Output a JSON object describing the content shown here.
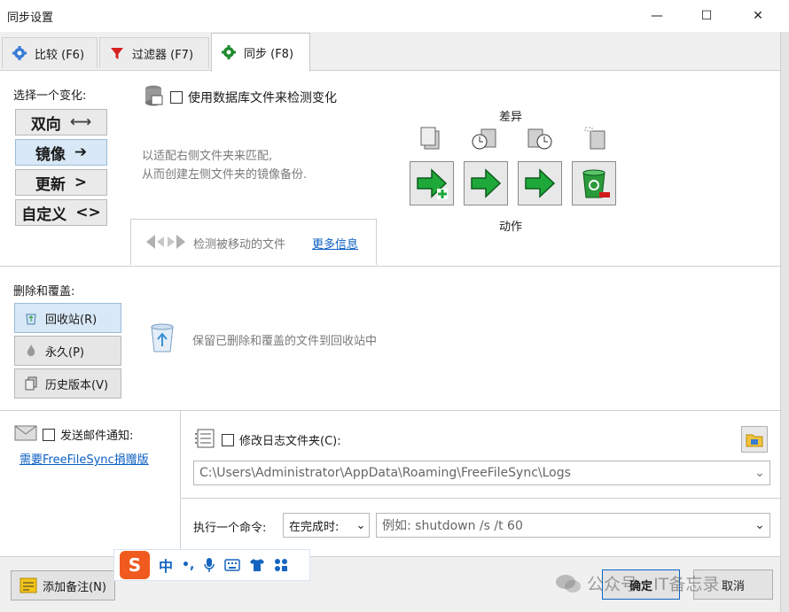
{
  "window": {
    "title": "同步设置",
    "minimize": "—",
    "maximize": "☐",
    "close": "✕"
  },
  "tabs": [
    {
      "label": "比较 (F6)",
      "icon": "gear-blue-icon"
    },
    {
      "label": "过滤器 (F7)",
      "icon": "funnel-icon"
    },
    {
      "label": "同步 (F8)",
      "icon": "gear-green-icon"
    }
  ],
  "variant": {
    "heading": "选择一个变化:",
    "options": [
      {
        "label": "双向",
        "glyph": "⟷"
      },
      {
        "label": "镜像",
        "glyph": "➔"
      },
      {
        "label": "更新",
        "glyph": ">"
      },
      {
        "label": "自定义",
        "glyph": "<>"
      }
    ],
    "selected_index": 1
  },
  "db_check": {
    "label": "使用数据库文件来检测变化",
    "checked": false
  },
  "description": {
    "line1": "以适配右侧文件夹来匹配,",
    "line2": "从而创建左侧文件夹的镜像备份."
  },
  "moved": {
    "label": "检测被移动的文件",
    "link": "更多信息"
  },
  "diff": {
    "heading": "差异",
    "footer": "动作"
  },
  "deletion": {
    "heading": "删除和覆盖:",
    "options": [
      {
        "label": "回收站(R)"
      },
      {
        "label": "永久(P)"
      },
      {
        "label": "历史版本(V)"
      }
    ],
    "selected_index": 0,
    "hint": "保留已删除和覆盖的文件到回收站中"
  },
  "email": {
    "label": "发送邮件通知:",
    "checked": false,
    "link": "需要FreeFileSync捐赠版"
  },
  "log": {
    "label": "修改日志文件夹(C):",
    "checked": false,
    "path": "C:\\Users\\Administrator\\AppData\\Roaming\\FreeFileSync\\Logs"
  },
  "command": {
    "label": "执行一个命令:",
    "when": "在完成时:",
    "placeholder": "例如: shutdown /s /t 60"
  },
  "footer": {
    "note_button": "添加备注(N)",
    "ok_button": "确定",
    "cancel_button": "取消",
    "watermark": "公众号 · IT备忘录"
  },
  "ime": {
    "logo": "S",
    "items": [
      "中",
      "•,",
      "mic",
      "keyboard",
      "shirt",
      "apps"
    ]
  }
}
